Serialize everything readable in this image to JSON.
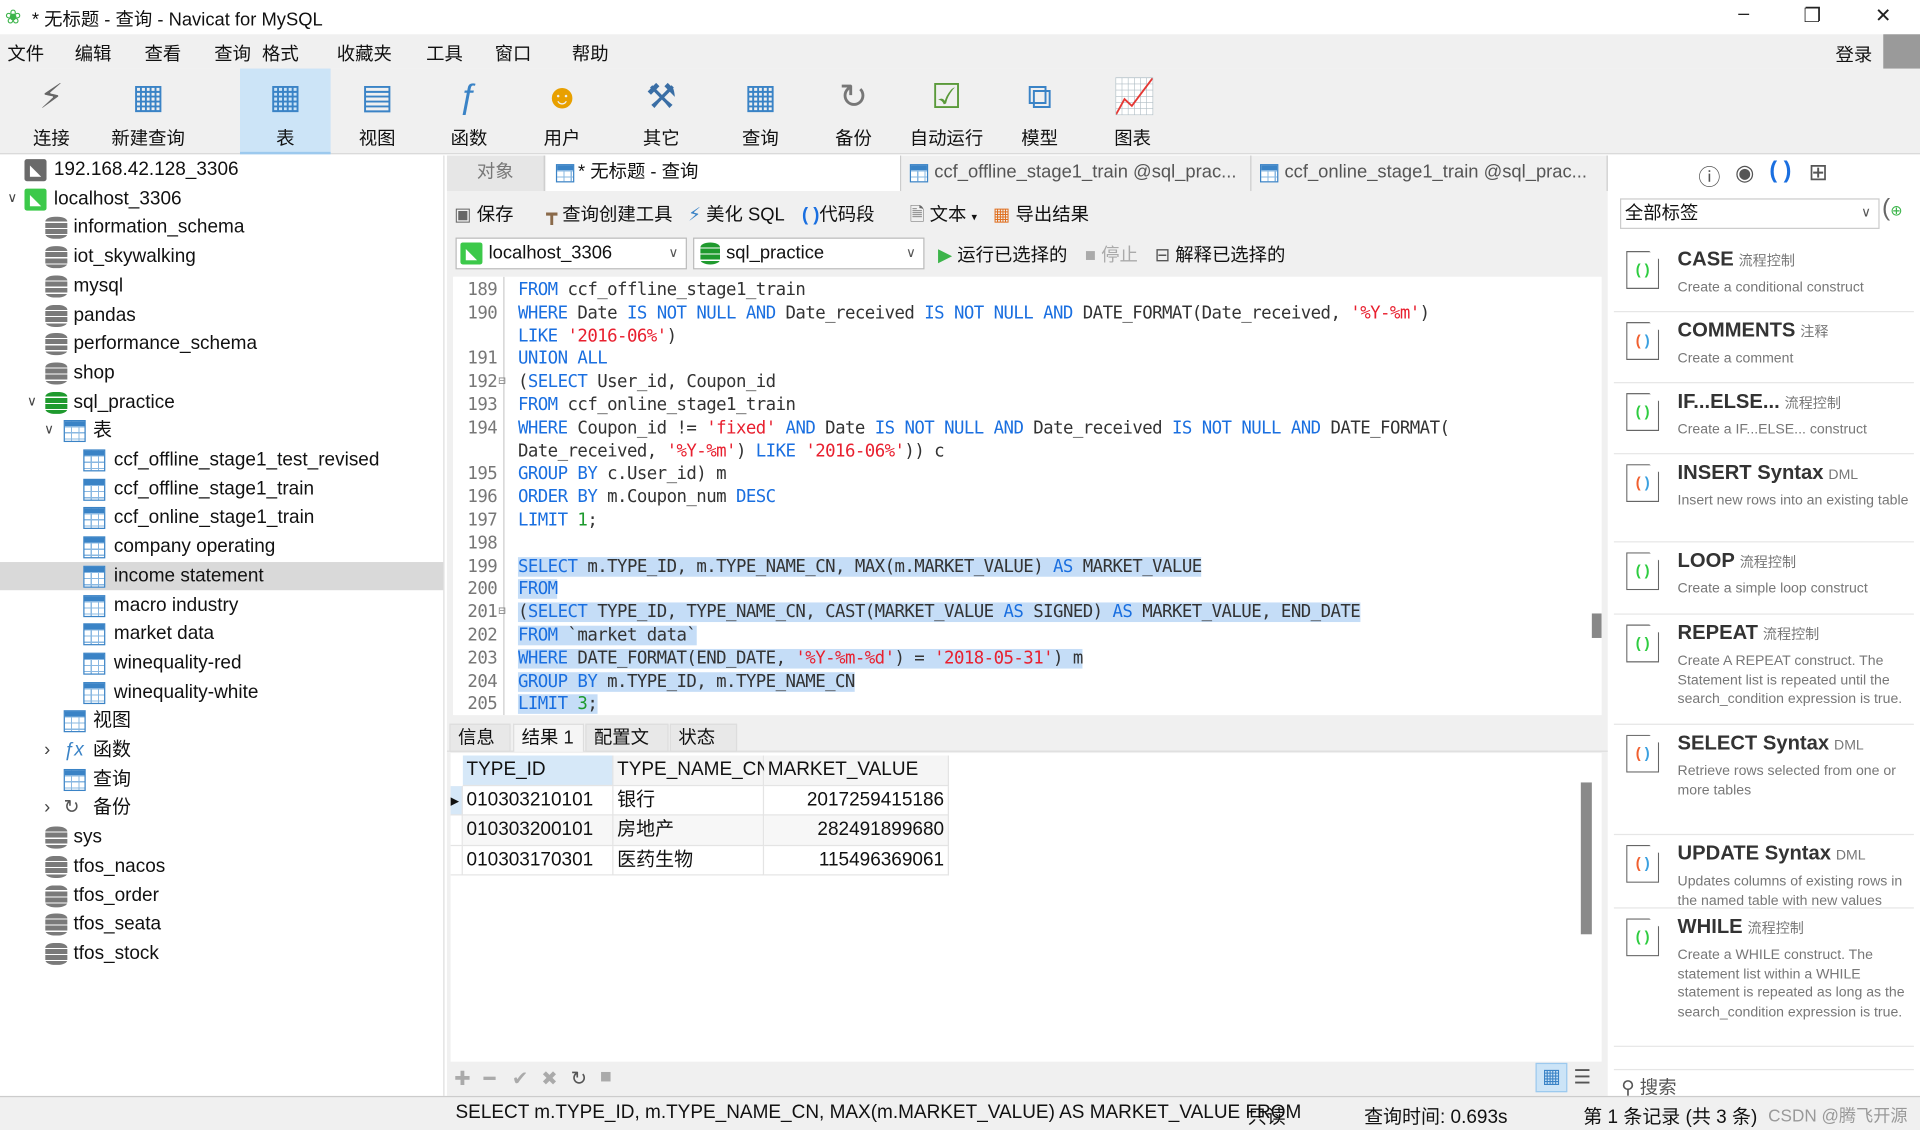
{
  "window": {
    "title": "* 无标题 - 查询 - Navicat for MySQL",
    "minimize": "–",
    "restore": "❐",
    "close": "✕"
  },
  "menu": [
    "文件",
    "编辑",
    "查看",
    "查询",
    "格式",
    "收藏夹",
    "工具",
    "窗口",
    "帮助"
  ],
  "login": "登录",
  "toolbar": [
    {
      "label": "连接",
      "icon": "plug-icon"
    },
    {
      "label": "新建查询",
      "icon": "new-query-icon"
    },
    {
      "label": "表",
      "icon": "table-icon",
      "active": true
    },
    {
      "label": "视图",
      "icon": "view-icon"
    },
    {
      "label": "函数",
      "icon": "function-icon"
    },
    {
      "label": "用户",
      "icon": "user-icon"
    },
    {
      "label": "其它",
      "icon": "tools-icon"
    },
    {
      "label": "查询",
      "icon": "query-icon"
    },
    {
      "label": "备份",
      "icon": "backup-icon"
    },
    {
      "label": "自动运行",
      "icon": "schedule-icon"
    },
    {
      "label": "模型",
      "icon": "model-icon"
    },
    {
      "label": "图表",
      "icon": "chart-icon"
    }
  ],
  "tree": [
    {
      "label": "192.168.42.128_3306",
      "type": "server-gray",
      "lvl": 0
    },
    {
      "label": "localhost_3306",
      "type": "server-green",
      "lvl": 0,
      "open": true
    },
    {
      "label": "information_schema",
      "type": "db",
      "lvl": 1
    },
    {
      "label": "iot_skywalking",
      "type": "db",
      "lvl": 1
    },
    {
      "label": "mysql",
      "type": "db",
      "lvl": 1
    },
    {
      "label": "pandas",
      "type": "db",
      "lvl": 1
    },
    {
      "label": "performance_schema",
      "type": "db",
      "lvl": 1
    },
    {
      "label": "shop",
      "type": "db",
      "lvl": 1
    },
    {
      "label": "sql_practice",
      "type": "db-green",
      "lvl": 1,
      "open": true
    },
    {
      "label": "表",
      "type": "tables",
      "lvl": 2,
      "open": true
    },
    {
      "label": "ccf_offline_stage1_test_revised",
      "type": "table",
      "lvl": 3
    },
    {
      "label": "ccf_offline_stage1_train",
      "type": "table",
      "lvl": 3
    },
    {
      "label": "ccf_online_stage1_train",
      "type": "table",
      "lvl": 3
    },
    {
      "label": "company operating",
      "type": "table",
      "lvl": 3
    },
    {
      "label": "income statement",
      "type": "table",
      "lvl": 3,
      "selected": true
    },
    {
      "label": "macro industry",
      "type": "table",
      "lvl": 3
    },
    {
      "label": "market data",
      "type": "table",
      "lvl": 3
    },
    {
      "label": "winequality-red",
      "type": "table",
      "lvl": 3
    },
    {
      "label": "winequality-white",
      "type": "table",
      "lvl": 3
    },
    {
      "label": "视图",
      "type": "views",
      "lvl": 2
    },
    {
      "label": "函数",
      "type": "functions",
      "lvl": 2,
      "closed": true
    },
    {
      "label": "查询",
      "type": "queries",
      "lvl": 2
    },
    {
      "label": "备份",
      "type": "backups",
      "lvl": 2,
      "closed": true
    },
    {
      "label": "sys",
      "type": "db",
      "lvl": 1
    },
    {
      "label": "tfos_nacos",
      "type": "db",
      "lvl": 1
    },
    {
      "label": "tfos_order",
      "type": "db",
      "lvl": 1
    },
    {
      "label": "tfos_seata",
      "type": "db",
      "lvl": 1
    },
    {
      "label": "tfos_stock",
      "type": "db",
      "lvl": 1
    }
  ],
  "tabs": [
    "对象",
    "* 无标题 - 查询",
    "ccf_offline_stage1_train @sql_prac...",
    "ccf_online_stage1_train @sql_prac..."
  ],
  "query_toolbar": {
    "save": "保存",
    "builder": "查询创建工具",
    "beautify": "美化 SQL",
    "snippet": "代码段",
    "text": "文本",
    "export": "导出结果"
  },
  "connection": {
    "server": "localhost_3306",
    "database": "sql_practice",
    "run": "运行已选择的",
    "stop": "停止",
    "explain": "解释已选择的"
  },
  "code": [
    {
      "n": "189",
      "t": [
        [
          "k",
          "FROM"
        ],
        [
          "p",
          " ccf_offline_stage1_train"
        ]
      ]
    },
    {
      "n": "190",
      "t": [
        [
          "k",
          "WHERE"
        ],
        [
          "p",
          " Date "
        ],
        [
          "k",
          "IS NOT NULL AND"
        ],
        [
          "p",
          " Date_received "
        ],
        [
          "k",
          "IS NOT NULL AND"
        ],
        [
          "p",
          " DATE_FORMAT(Date_received, "
        ],
        [
          "s",
          "'%Y-%m'"
        ],
        [
          "p",
          ")"
        ]
      ]
    },
    {
      "n": "",
      "t": [
        [
          "k",
          "LIKE"
        ],
        [
          "p",
          " "
        ],
        [
          "s",
          "'2016-06%'"
        ],
        [
          "p",
          ")"
        ]
      ]
    },
    {
      "n": "191",
      "t": [
        [
          "k",
          "UNION ALL"
        ]
      ]
    },
    {
      "n": "192",
      "fold": true,
      "t": [
        [
          "p",
          "("
        ],
        [
          "k",
          "SELECT"
        ],
        [
          "p",
          " User_id, Coupon_id"
        ]
      ]
    },
    {
      "n": "193",
      "t": [
        [
          "k",
          "FROM"
        ],
        [
          "p",
          " ccf_online_stage1_train"
        ]
      ]
    },
    {
      "n": "194",
      "t": [
        [
          "k",
          "WHERE"
        ],
        [
          "p",
          " Coupon_id != "
        ],
        [
          "s",
          "'fixed'"
        ],
        [
          "p",
          " "
        ],
        [
          "k",
          "AND"
        ],
        [
          "p",
          " Date "
        ],
        [
          "k",
          "IS NOT NULL AND"
        ],
        [
          "p",
          " Date_received "
        ],
        [
          "k",
          "IS NOT NULL AND"
        ],
        [
          "p",
          " DATE_FORMAT("
        ]
      ]
    },
    {
      "n": "",
      "t": [
        [
          "p",
          "Date_received, "
        ],
        [
          "s",
          "'%Y-%m'"
        ],
        [
          "p",
          ") "
        ],
        [
          "k",
          "LIKE"
        ],
        [
          "p",
          " "
        ],
        [
          "s",
          "'2016-06%'"
        ],
        [
          "p",
          ")) c"
        ]
      ]
    },
    {
      "n": "195",
      "t": [
        [
          "k",
          "GROUP BY"
        ],
        [
          "p",
          " c.User_id) m"
        ]
      ]
    },
    {
      "n": "196",
      "t": [
        [
          "k",
          "ORDER BY"
        ],
        [
          "p",
          " m.Coupon_num "
        ],
        [
          "k",
          "DESC"
        ]
      ]
    },
    {
      "n": "197",
      "t": [
        [
          "k",
          "LIMIT"
        ],
        [
          "p",
          " "
        ],
        [
          "n",
          "1"
        ],
        [
          "p",
          ";"
        ]
      ]
    },
    {
      "n": "198",
      "t": []
    },
    {
      "n": "199",
      "sel": true,
      "t": [
        [
          "k",
          "SELECT"
        ],
        [
          "p",
          " m.TYPE_ID, m.TYPE_NAME_CN, MAX(m.MARKET_VALUE) "
        ],
        [
          "k",
          "AS"
        ],
        [
          "p",
          " MARKET_VALUE"
        ]
      ]
    },
    {
      "n": "200",
      "sel": true,
      "t": [
        [
          "k",
          "FROM"
        ]
      ]
    },
    {
      "n": "201",
      "sel": true,
      "fold": true,
      "t": [
        [
          "p",
          "("
        ],
        [
          "k",
          "SELECT"
        ],
        [
          "p",
          " TYPE_ID, TYPE_NAME_CN, CAST(MARKET_VALUE "
        ],
        [
          "k",
          "AS"
        ],
        [
          "p",
          " SIGNED) "
        ],
        [
          "k",
          "AS"
        ],
        [
          "p",
          " MARKET_VALUE, END_DATE"
        ]
      ]
    },
    {
      "n": "202",
      "sel": true,
      "t": [
        [
          "k",
          "FROM"
        ],
        [
          "p",
          " `market data`"
        ]
      ]
    },
    {
      "n": "203",
      "sel": true,
      "t": [
        [
          "k",
          "WHERE"
        ],
        [
          "p",
          " DATE_FORMAT(END_DATE, "
        ],
        [
          "s",
          "'%Y-%m-%d'"
        ],
        [
          "p",
          ") = "
        ],
        [
          "s",
          "'2018-05-31'"
        ],
        [
          "p",
          ") m"
        ]
      ]
    },
    {
      "n": "204",
      "sel": true,
      "t": [
        [
          "k",
          "GROUP BY"
        ],
        [
          "p",
          " m.TYPE_ID, m.TYPE_NAME_CN"
        ]
      ]
    },
    {
      "n": "205",
      "sel": true,
      "t": [
        [
          "k",
          "LIMIT"
        ],
        [
          "p",
          " "
        ],
        [
          "n",
          "3"
        ],
        [
          "p",
          ";"
        ]
      ]
    }
  ],
  "result_tabs": [
    "信息",
    "结果 1",
    "配置文件",
    "状态"
  ],
  "result": {
    "columns": [
      "TYPE_ID",
      "TYPE_NAME_CN",
      "MARKET_VALUE"
    ],
    "rows": [
      [
        "010303210101",
        "银行",
        "2017259415186"
      ],
      [
        "010303200101",
        "房地产",
        "282491899680"
      ],
      [
        "010303170301",
        "医药生物",
        "115496369061"
      ]
    ]
  },
  "snippets": {
    "filter": "全部标签",
    "search_placeholder": "搜索",
    "items": [
      {
        "name": "CASE",
        "tag": "流程控制",
        "desc": "Create a conditional construct",
        "color": "green"
      },
      {
        "name": "COMMENTS",
        "tag": "注释",
        "desc": "Create a comment",
        "color": "multi"
      },
      {
        "name": "IF...ELSE...",
        "tag": "流程控制",
        "desc": "Create a IF...ELSE... construct",
        "color": "green"
      },
      {
        "name": "INSERT Syntax",
        "tag": "DML",
        "desc": "Insert new rows into an existing table",
        "color": "multi"
      },
      {
        "name": "LOOP",
        "tag": "流程控制",
        "desc": "Create a simple loop construct",
        "color": "green"
      },
      {
        "name": "REPEAT",
        "tag": "流程控制",
        "desc": "Create A REPEAT construct. The Statement list is repeated until the search_condition expression is true.",
        "color": "green"
      },
      {
        "name": "SELECT Syntax",
        "tag": "DML",
        "desc": "Retrieve rows selected from one or more tables",
        "color": "multi"
      },
      {
        "name": "UPDATE Syntax",
        "tag": "DML",
        "desc": "Updates columns of existing rows in the named table with new values",
        "color": "multi"
      },
      {
        "name": "WHILE",
        "tag": "流程控制",
        "desc": "Create a WHILE construct. The statement list within a WHILE statement is repeated as long as the search_condition expression is true.",
        "color": "green"
      }
    ]
  },
  "status": {
    "sql": "SELECT m.TYPE_ID, m.TYPE_NAME_CN, MAX(m.MARKET_VALUE) AS MARKET_VALUE FROM",
    "mode": "只读",
    "time": "查询时间: 0.693s",
    "records": "第 1 条记录 (共 3 条)",
    "watermark": "CSDN @腾飞开源"
  }
}
